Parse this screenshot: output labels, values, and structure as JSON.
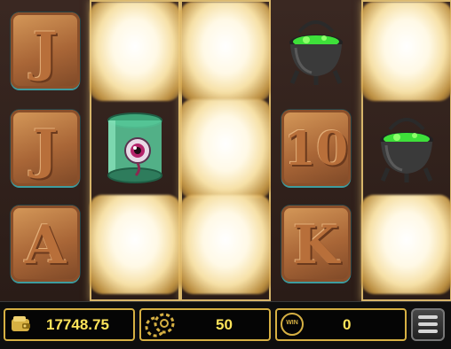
{
  "reels": [
    {
      "highlight": false,
      "symbols": [
        "J",
        "J",
        "A"
      ]
    },
    {
      "highlight": true,
      "symbols": [
        "glow",
        "eyeball-jar",
        "glow"
      ]
    },
    {
      "highlight": true,
      "symbols": [
        "glow",
        "glow",
        "glow"
      ]
    },
    {
      "highlight": false,
      "symbols": [
        "cauldron",
        "10",
        "K"
      ]
    },
    {
      "highlight": true,
      "symbols": [
        "glow",
        "cauldron",
        "glow"
      ]
    }
  ],
  "bottom_bar": {
    "balance": "17748.75",
    "bet": "50",
    "win_badge": "WIN",
    "win": "0"
  },
  "icons": {
    "balance": "wallet-icon",
    "bet": "chip-stack-icon",
    "win": "win-badge-icon",
    "menu": "hamburger-menu-icon"
  },
  "colors": {
    "accent_gold": "#d6b043",
    "value_yellow": "#ffe45a",
    "potion_green": "#3ee03a"
  }
}
